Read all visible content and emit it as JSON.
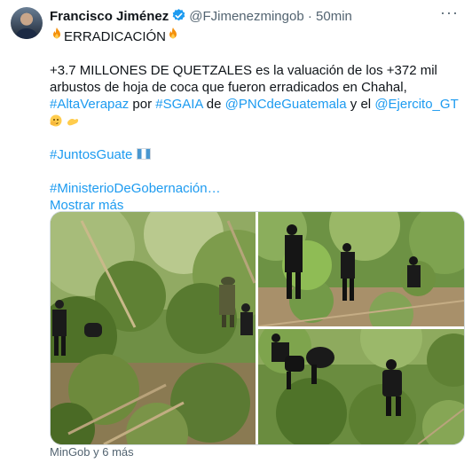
{
  "author": {
    "name": "Francisco Jiménez",
    "handle": "@FJimenezmingob",
    "separator": "·",
    "time": "50min"
  },
  "tweet": {
    "line1_text": "ERRADICACIÓN",
    "body_main": "+3.7 MILLONES DE QUETZALES es la valuación de los +372 mil arbustos de hoja de coca que fueron erradicados en Chahal, ",
    "hashtag_alta_verapaz": "#AltaVerapaz",
    "word_por": " por ",
    "hashtag_sgaia": "#SGAIA",
    "word_de": " de ",
    "mention_pnc": "@PNCdeGuatemala",
    "word_y_el": " y el ",
    "mention_ejercito": "@Ejercito_GT",
    "hashtag_juntos": "#JuntosGuate",
    "hashtag_ministerio": "#MinisterioDeGobernación…",
    "show_more": "Mostrar más"
  },
  "media_footer": "MinGob y 6 más",
  "icons": {
    "verified": "verified-badge-icon",
    "more": "more-options-icon",
    "fire": "fire-emoji",
    "flag": "guatemala-flag-emoji",
    "hands": "hands-emoji"
  },
  "colors": {
    "link": "#1d9bf0",
    "verified": "#1d9bf0",
    "secondary_text": "#536471",
    "border": "#cfd9de"
  }
}
